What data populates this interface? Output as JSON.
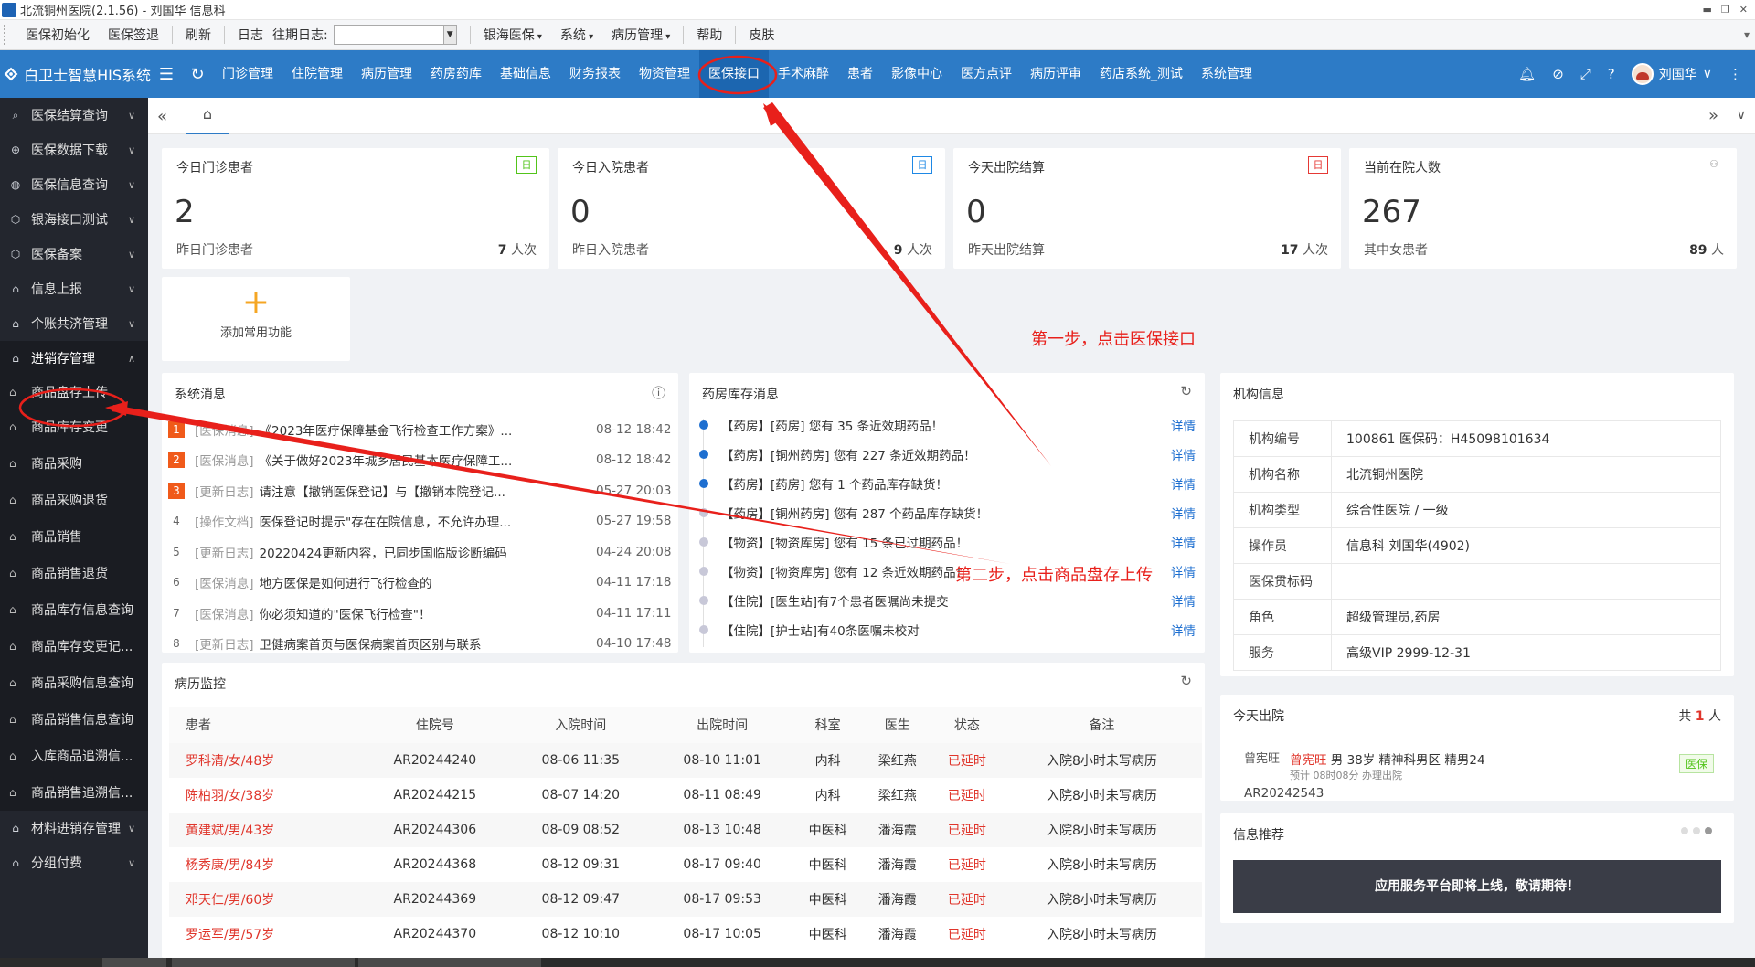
{
  "window": {
    "title": "北流铜州医院(2.1.56) - 刘国华 信息科",
    "controls": [
      "▬",
      "❐",
      "✕"
    ]
  },
  "menubar": {
    "items_left": [
      "医保初始化",
      "医保签退"
    ],
    "refresh": "刷新",
    "log": "日志",
    "past_log_label": "往期日志:",
    "past_log_value": "",
    "items_right": [
      {
        "label": "银海医保",
        "dropdown": true
      },
      {
        "label": "系统",
        "dropdown": true
      },
      {
        "label": "病历管理",
        "dropdown": true
      }
    ],
    "help": "帮助",
    "skin": "皮肤"
  },
  "topnav": {
    "brand": "白卫士智慧HIS系统",
    "items": [
      "门诊管理",
      "住院管理",
      "病历管理",
      "药房药库",
      "基础信息",
      "财务报表",
      "物资管理",
      "医保接口",
      "手术麻醉",
      "患者",
      "影像中心",
      "医方点评",
      "病历评审",
      "药店系统_测试",
      "系统管理"
    ],
    "highlighted": "医保接口",
    "user": "刘国华",
    "icons": [
      "bell-icon",
      "tag-icon",
      "fullscreen-icon",
      "help-icon"
    ]
  },
  "sidebar": {
    "groups": [
      {
        "label": "医保结算查询",
        "icon": "search-icon"
      },
      {
        "label": "医保数据下载",
        "icon": "download-icon"
      },
      {
        "label": "医保信息查询",
        "icon": "globe-icon"
      },
      {
        "label": "银海接口测试",
        "icon": "cube-icon"
      },
      {
        "label": "医保备案",
        "icon": "cube-icon"
      },
      {
        "label": "信息上报",
        "icon": "home-icon"
      },
      {
        "label": "个账共济管理",
        "icon": "home-icon"
      },
      {
        "label": "进销存管理",
        "icon": "home-icon",
        "open": true
      }
    ],
    "subitems": [
      "商品盘存上传",
      "商品库存变更",
      "商品采购",
      "商品采购退货",
      "商品销售",
      "商品销售退货",
      "商品库存信息查询",
      "商品库存变更记...",
      "商品采购信息查询",
      "商品销售信息查询",
      "入库商品追溯信...",
      "商品销售追溯信..."
    ],
    "after": [
      {
        "label": "材料进销存管理",
        "icon": "home-icon"
      },
      {
        "label": "分组付费",
        "icon": "home-icon"
      }
    ]
  },
  "stats": [
    {
      "title": "今日门诊患者",
      "badge": "日",
      "badge_color": "#52c41a",
      "value": "2",
      "sub_label": "昨日门诊患者",
      "sub_value": "7",
      "unit": "人次"
    },
    {
      "title": "今日入院患者",
      "badge": "日",
      "badge_color": "#1e88e5",
      "value": "0",
      "sub_label": "昨日入院患者",
      "sub_value": "9",
      "unit": "人次"
    },
    {
      "title": "今天出院结算",
      "badge": "日",
      "badge_color": "#e53935",
      "value": "0",
      "sub_label": "昨天出院结算",
      "sub_value": "17",
      "unit": "人次"
    },
    {
      "title": "当前在院人数",
      "badge": "",
      "badge_color": "",
      "value": "267",
      "sub_label": "其中女患者",
      "sub_value": "89",
      "unit": "人"
    }
  ],
  "add_function": "添加常用功能",
  "system_messages": {
    "title": "系统消息",
    "items": [
      {
        "n": "1",
        "cat": "[医保消息]",
        "text": "《2023年医疗保障基金飞行检查工作方案》...",
        "date": "08-12 18:42"
      },
      {
        "n": "2",
        "cat": "[医保消息]",
        "text": "《关于做好2023年城乡居民基本医疗保障工...",
        "date": "08-12 18:42"
      },
      {
        "n": "3",
        "cat": "[更新日志]",
        "text": "请注意【撤销医保登记】与【撤销本院登记...",
        "date": "05-27 20:03"
      },
      {
        "n": "4",
        "cat": "[操作文档]",
        "text": "医保登记时提示\"存在在院信息，不允许办理...",
        "date": "05-27 19:58"
      },
      {
        "n": "5",
        "cat": "[更新日志]",
        "text": "20220424更新内容，已同步国临版诊断编码",
        "date": "04-24 20:08"
      },
      {
        "n": "6",
        "cat": "[医保消息]",
        "text": "地方医保是如何进行飞行检查的",
        "date": "04-11 17:18"
      },
      {
        "n": "7",
        "cat": "[医保消息]",
        "text": "你必须知道的\"医保飞行检查\"！",
        "date": "04-11 17:11"
      },
      {
        "n": "8",
        "cat": "[更新日志]",
        "text": "卫健病案首页与医保病案首页区别与联系",
        "date": "04-10 17:48"
      }
    ]
  },
  "stock_messages": {
    "title": "药房库存消息",
    "link": "详情",
    "items": [
      {
        "text": "【药房】[药房] 您有 35 条近效期药品！",
        "dot": "#1e6fd0"
      },
      {
        "text": "【药房】[铜州药房] 您有 227 条近效期药品！",
        "dot": "#1e6fd0"
      },
      {
        "text": "【药房】[药房] 您有 1 个药品库存缺货！",
        "dot": "#1e6fd0"
      },
      {
        "text": "【药房】[铜州药房] 您有 287 个药品库存缺货！",
        "dot": "#c8c8d8"
      },
      {
        "text": "【物资】[物资库房] 您有 15 条已过期药品！",
        "dot": "#c8c8d8"
      },
      {
        "text": "【物资】[物资库房] 您有 12 条近效期药品！",
        "dot": "#c8c8d8"
      },
      {
        "text": "【住院】[医生站]有7个患者医嘱尚未提交",
        "dot": "#c8c8d8"
      },
      {
        "text": "【住院】[护士站]有40条医嘱未校对",
        "dot": "#c8c8d8"
      }
    ]
  },
  "org_info": {
    "title": "机构信息",
    "rows": [
      {
        "k": "机构编号",
        "v": "100861 医保码：H45098101634"
      },
      {
        "k": "机构名称",
        "v": "北流铜州医院"
      },
      {
        "k": "机构类型",
        "v": "综合性医院 / 一级"
      },
      {
        "k": "操作员",
        "v": "信息科 刘国华(4902)"
      },
      {
        "k": "医保贯标码",
        "v": ""
      },
      {
        "k": "角色",
        "v": "超级管理员,药房"
      },
      {
        "k": "服务",
        "v": "高级VIP 2999-12-31"
      }
    ]
  },
  "medical_records": {
    "title": "病历监控",
    "headers": [
      "患者",
      "住院号",
      "入院时间",
      "出院时间",
      "科室",
      "医生",
      "状态",
      "备注"
    ],
    "rows": [
      [
        "罗科清/女/48岁",
        "AR20244240",
        "08-06 11:35",
        "08-10 11:01",
        "内科",
        "梁红燕",
        "已延时",
        "入院8小时未写病历"
      ],
      [
        "陈柏羽/女/38岁",
        "AR20244215",
        "08-07 14:20",
        "08-11 08:49",
        "内科",
        "梁红燕",
        "已延时",
        "入院8小时未写病历"
      ],
      [
        "黄建斌/男/43岁",
        "AR20244306",
        "08-09 08:52",
        "08-13 10:48",
        "中医科",
        "潘海霞",
        "已延时",
        "入院8小时未写病历"
      ],
      [
        "杨秀康/男/84岁",
        "AR20244368",
        "08-12 09:31",
        "08-17 09:40",
        "中医科",
        "潘海霞",
        "已延时",
        "入院8小时未写病历"
      ],
      [
        "邓天仁/男/60岁",
        "AR20244369",
        "08-12 09:47",
        "08-17 09:53",
        "中医科",
        "潘海霞",
        "已延时",
        "入院8小时未写病历"
      ],
      [
        "罗运军/男/57岁",
        "AR20244370",
        "08-12 10:10",
        "08-17 10:05",
        "中医科",
        "潘海霞",
        "已延时",
        "入院8小时未写病历"
      ]
    ]
  },
  "today_discharge": {
    "title": "今天出院",
    "count_prefix": "共",
    "count": "1",
    "count_unit": "人",
    "photo_alt": "曾宪旺",
    "name": "曾宪旺",
    "info": "男 38岁 精神科男区 精男24",
    "sub": "预计 08时08分 办理出院",
    "id": "AR20242543",
    "tag": "医保"
  },
  "recommend": {
    "title": "信息推荐",
    "banner": "应用服务平台即将上线，敬请期待！"
  },
  "annotations": {
    "step1": "第一步，点击医保接口",
    "step2": "第二步，点击商品盘存上传",
    "color": "#e8201b"
  }
}
